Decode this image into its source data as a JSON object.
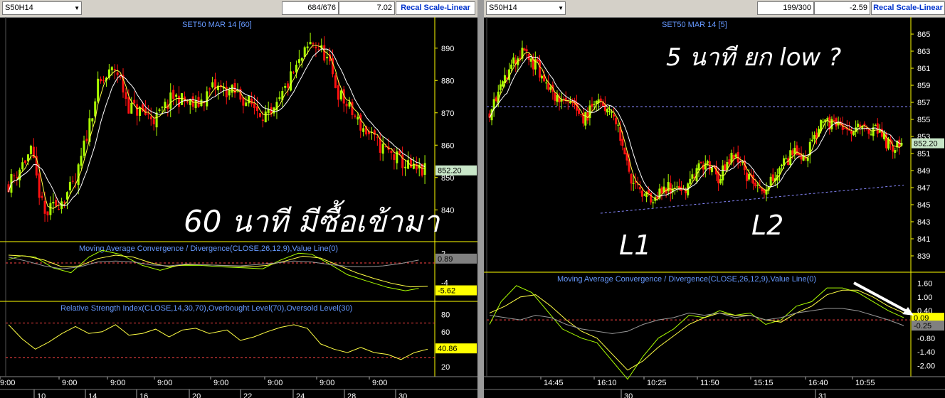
{
  "colors": {
    "bg": "#000000",
    "up": "#aaff00",
    "down": "#ff1111",
    "axis": "#ffff00",
    "grid": "#ffffff",
    "title": "#6699ff",
    "ma1": "#ffff44",
    "ma2": "#ffffff",
    "ref": "#ff4444",
    "arrow": "#ffffff"
  },
  "left": {
    "symbol": "S50H14",
    "count": "684/676",
    "value": "7.02",
    "recal": "Recal Scale-Linear",
    "title": "SET50 MAR 14  [60]",
    "annotation": "60 นาที มีซื้อเข้ามา",
    "last_price": "852.20",
    "macd_title": "Moving Average Convergence / Divergence(CLOSE,26,12,9),Value Line(0)",
    "macd_val1": "0.89",
    "macd_val2": "-5.62",
    "rsi_title": "Relative Strength Index(CLOSE,14,30,70),Overbought Level(70),Oversold Level(30)",
    "rsi_val": "40.86",
    "time_labels": [
      "9:00",
      "9:00",
      "9:00",
      "9:00",
      "9:00",
      "9:00",
      "9:00",
      "9:00"
    ],
    "date_labels": [
      "10",
      "14",
      "16",
      "20",
      "22",
      "24",
      "28",
      "30"
    ]
  },
  "right": {
    "symbol": "S50H14",
    "count": "199/300",
    "value": "-2.59",
    "recal": "Recal Scale-Linear",
    "title": "SET50 MAR 14  [5]",
    "annotation": "5 นาที ยก low ?",
    "label_l1": "L1",
    "label_l2": "L2",
    "last_price": "852.20",
    "macd_title": "Moving Average Convergence / Divergence(CLOSE,26,12,9),Value Line(0)",
    "macd_val1": "0.09",
    "macd_val2": "-0.25",
    "time_labels": [
      "14:45",
      "16:10",
      "10:25",
      "11:50",
      "15:15",
      "16:40",
      "10:55"
    ],
    "date_labels": [
      "30",
      "31"
    ]
  },
  "chart_data": [
    {
      "type": "candlestick",
      "title": "SET50 MAR 14  [60]",
      "y_ticks": [
        840,
        850,
        860,
        870,
        880,
        890
      ],
      "ylim": [
        835,
        895
      ],
      "close_path": [
        [
          0,
          848
        ],
        [
          5,
          858
        ],
        [
          8,
          838
        ],
        [
          11,
          842
        ],
        [
          15,
          848
        ],
        [
          20,
          878
        ],
        [
          24,
          884
        ],
        [
          27,
          872
        ],
        [
          33,
          868
        ],
        [
          37,
          875
        ],
        [
          42,
          872
        ],
        [
          46,
          878
        ],
        [
          51,
          876
        ],
        [
          55,
          872
        ],
        [
          59,
          868
        ],
        [
          63,
          880
        ],
        [
          68,
          892
        ],
        [
          71,
          888
        ],
        [
          74,
          876
        ],
        [
          79,
          866
        ],
        [
          83,
          860
        ],
        [
          87,
          856
        ],
        [
          91,
          852
        ],
        [
          94,
          852
        ]
      ],
      "macd_ticks": [
        2,
        -4
      ],
      "macd": {
        "value1": 0.89,
        "value2": -5.62
      },
      "rsi_ticks": [
        80,
        60,
        40,
        20
      ],
      "rsi": {
        "last": 40.86,
        "overbought": 70,
        "oversold": 30
      },
      "macd_lines": {
        "a": [
          [
            0,
            0.7
          ],
          [
            3,
            1.5
          ],
          [
            6,
            1.2
          ],
          [
            10,
            -1
          ],
          [
            14,
            -2
          ],
          [
            18,
            1.2
          ],
          [
            21,
            2.6
          ],
          [
            25,
            1.8
          ],
          [
            30,
            -0.5
          ],
          [
            34,
            -1.5
          ],
          [
            38,
            -0.5
          ],
          [
            43,
            -0.5
          ],
          [
            48,
            -0.8
          ],
          [
            53,
            -1
          ],
          [
            57,
            -1.2
          ],
          [
            61,
            0.6
          ],
          [
            65,
            2
          ],
          [
            68,
            1.8
          ],
          [
            72,
            -0.2
          ],
          [
            76,
            -2.4
          ],
          [
            80,
            -3.6
          ],
          [
            85,
            -5
          ],
          [
            89,
            -5.7
          ],
          [
            92,
            -5.2
          ]
        ],
        "b": [
          [
            0,
            1.6
          ],
          [
            4,
            1.4
          ],
          [
            8,
            0.6
          ],
          [
            12,
            -0.8
          ],
          [
            16,
            -0.6
          ],
          [
            20,
            0.9
          ],
          [
            24,
            1.6
          ],
          [
            28,
            1.2
          ],
          [
            32,
            0
          ],
          [
            36,
            -0.8
          ],
          [
            40,
            -0.3
          ],
          [
            45,
            -0.4
          ],
          [
            50,
            -0.6
          ],
          [
            54,
            -0.8
          ],
          [
            58,
            -0.5
          ],
          [
            62,
            0.4
          ],
          [
            66,
            1.4
          ],
          [
            70,
            1
          ],
          [
            74,
            -0.5
          ],
          [
            78,
            -2
          ],
          [
            82,
            -3.2
          ],
          [
            86,
            -4.2
          ],
          [
            90,
            -4.9
          ],
          [
            94,
            -4.8
          ]
        ],
        "c": [
          [
            0,
            1.2
          ],
          [
            4,
            0.4
          ],
          [
            8,
            -0.6
          ],
          [
            12,
            -1.2
          ],
          [
            16,
            -0.8
          ],
          [
            20,
            0.2
          ],
          [
            24,
            0.4
          ],
          [
            28,
            0.2
          ],
          [
            32,
            -0.4
          ],
          [
            36,
            -0.6
          ],
          [
            40,
            -0.2
          ],
          [
            44,
            -0.4
          ],
          [
            48,
            -0.5
          ],
          [
            52,
            -0.6
          ],
          [
            56,
            -0.3
          ],
          [
            60,
            0
          ],
          [
            64,
            0.4
          ],
          [
            68,
            0.2
          ],
          [
            72,
            -0.3
          ],
          [
            76,
            -0.7
          ],
          [
            80,
            -0.8
          ],
          [
            84,
            -0.6
          ],
          [
            88,
            -0.1
          ],
          [
            92,
            0.6
          ]
        ]
      },
      "rsi_line": [
        [
          0,
          68
        ],
        [
          3,
          52
        ],
        [
          6,
          40
        ],
        [
          9,
          48
        ],
        [
          12,
          58
        ],
        [
          15,
          66
        ],
        [
          18,
          58
        ],
        [
          21,
          60
        ],
        [
          24,
          68
        ],
        [
          27,
          56
        ],
        [
          30,
          58
        ],
        [
          33,
          63
        ],
        [
          36,
          54
        ],
        [
          39,
          62
        ],
        [
          42,
          64
        ],
        [
          45,
          58
        ],
        [
          49,
          62
        ],
        [
          52,
          50
        ],
        [
          55,
          54
        ],
        [
          58,
          60
        ],
        [
          61,
          65
        ],
        [
          64,
          68
        ],
        [
          67,
          64
        ],
        [
          70,
          46
        ],
        [
          73,
          40
        ],
        [
          76,
          36
        ],
        [
          79,
          42
        ],
        [
          82,
          36
        ],
        [
          85,
          34
        ],
        [
          88,
          28
        ],
        [
          91,
          36
        ],
        [
          94,
          40
        ]
      ]
    },
    {
      "type": "candlestick",
      "title": "SET50 MAR 14  [5]",
      "y_ticks": [
        839,
        841,
        843,
        845,
        847,
        849,
        851,
        853,
        855,
        857,
        859,
        861,
        863,
        865
      ],
      "ylim": [
        838,
        866
      ],
      "close_path": [
        [
          0,
          856
        ],
        [
          4,
          860
        ],
        [
          9,
          863
        ],
        [
          13,
          861
        ],
        [
          17,
          858
        ],
        [
          21,
          857
        ],
        [
          25,
          855
        ],
        [
          30,
          857
        ],
        [
          33,
          856
        ],
        [
          36,
          852
        ],
        [
          38,
          848
        ],
        [
          41,
          846
        ],
        [
          44,
          846
        ],
        [
          48,
          847
        ],
        [
          53,
          847
        ],
        [
          58,
          850
        ],
        [
          62,
          848
        ],
        [
          66,
          851
        ],
        [
          70,
          848
        ],
        [
          74,
          847
        ],
        [
          78,
          849
        ],
        [
          82,
          851
        ],
        [
          86,
          851
        ],
        [
          90,
          855
        ],
        [
          94,
          854
        ],
        [
          97,
          853
        ],
        [
          100,
          854
        ],
        [
          104,
          854
        ],
        [
          108,
          852
        ],
        [
          112,
          852
        ]
      ],
      "reference_line": 856.5,
      "trendline": [
        [
          30,
          844
        ],
        [
          112,
          847.3
        ]
      ],
      "macd_ticks": [
        1.6,
        1,
        0.4,
        -0.2,
        -0.8,
        -1.4,
        -2
      ],
      "macd": {
        "value1": 0.09,
        "value2": -0.25
      },
      "macd_lines": {
        "a": [
          [
            0,
            -0.2
          ],
          [
            3,
            0.8
          ],
          [
            7,
            1.5
          ],
          [
            11,
            1.2
          ],
          [
            15,
            0.4
          ],
          [
            19,
            -0.4
          ],
          [
            24,
            -0.8
          ],
          [
            28,
            -1
          ],
          [
            32,
            -1.8
          ],
          [
            36,
            -2.6
          ],
          [
            40,
            -1.6
          ],
          [
            44,
            -0.8
          ],
          [
            48,
            -0.4
          ],
          [
            52,
            0.2
          ],
          [
            56,
            0.1
          ],
          [
            60,
            0.4
          ],
          [
            64,
            0.2
          ],
          [
            68,
            0.3
          ],
          [
            72,
            -0.2
          ],
          [
            76,
            0
          ],
          [
            80,
            0.6
          ],
          [
            84,
            0.8
          ],
          [
            88,
            1.4
          ],
          [
            92,
            1.4
          ],
          [
            96,
            1.2
          ],
          [
            100,
            0.8
          ],
          [
            104,
            0.4
          ],
          [
            108,
            0.1
          ]
        ],
        "b": [
          [
            0,
            0.3
          ],
          [
            4,
            0.6
          ],
          [
            8,
            1
          ],
          [
            12,
            1.1
          ],
          [
            16,
            0.6
          ],
          [
            20,
            0
          ],
          [
            24,
            -0.5
          ],
          [
            28,
            -0.8
          ],
          [
            32,
            -1.5
          ],
          [
            36,
            -2.2
          ],
          [
            40,
            -1.8
          ],
          [
            44,
            -1.2
          ],
          [
            48,
            -0.7
          ],
          [
            52,
            -0.2
          ],
          [
            56,
            0.1
          ],
          [
            60,
            0.3
          ],
          [
            64,
            0.2
          ],
          [
            68,
            0.2
          ],
          [
            72,
            0
          ],
          [
            76,
            -0.1
          ],
          [
            80,
            0.3
          ],
          [
            84,
            0.6
          ],
          [
            88,
            1.1
          ],
          [
            92,
            1.3
          ],
          [
            96,
            1.3
          ],
          [
            100,
            1
          ],
          [
            104,
            0.6
          ],
          [
            108,
            0.3
          ]
        ],
        "c": [
          [
            0,
            0.2
          ],
          [
            4,
            0.1
          ],
          [
            8,
            0
          ],
          [
            12,
            0.2
          ],
          [
            16,
            0.1
          ],
          [
            20,
            -0.2
          ],
          [
            24,
            -0.4
          ],
          [
            28,
            -0.5
          ],
          [
            32,
            -0.6
          ],
          [
            36,
            -0.5
          ],
          [
            40,
            -0.2
          ],
          [
            44,
            0
          ],
          [
            48,
            0.1
          ],
          [
            52,
            0.3
          ],
          [
            56,
            0.2
          ],
          [
            60,
            0.3
          ],
          [
            64,
            0.1
          ],
          [
            68,
            0.2
          ],
          [
            72,
            0
          ],
          [
            76,
            0.1
          ],
          [
            80,
            0.3
          ],
          [
            84,
            0.4
          ],
          [
            88,
            0.5
          ],
          [
            92,
            0.5
          ],
          [
            96,
            0.4
          ],
          [
            100,
            0.2
          ],
          [
            104,
            0
          ],
          [
            108,
            -0.25
          ]
        ]
      }
    }
  ]
}
